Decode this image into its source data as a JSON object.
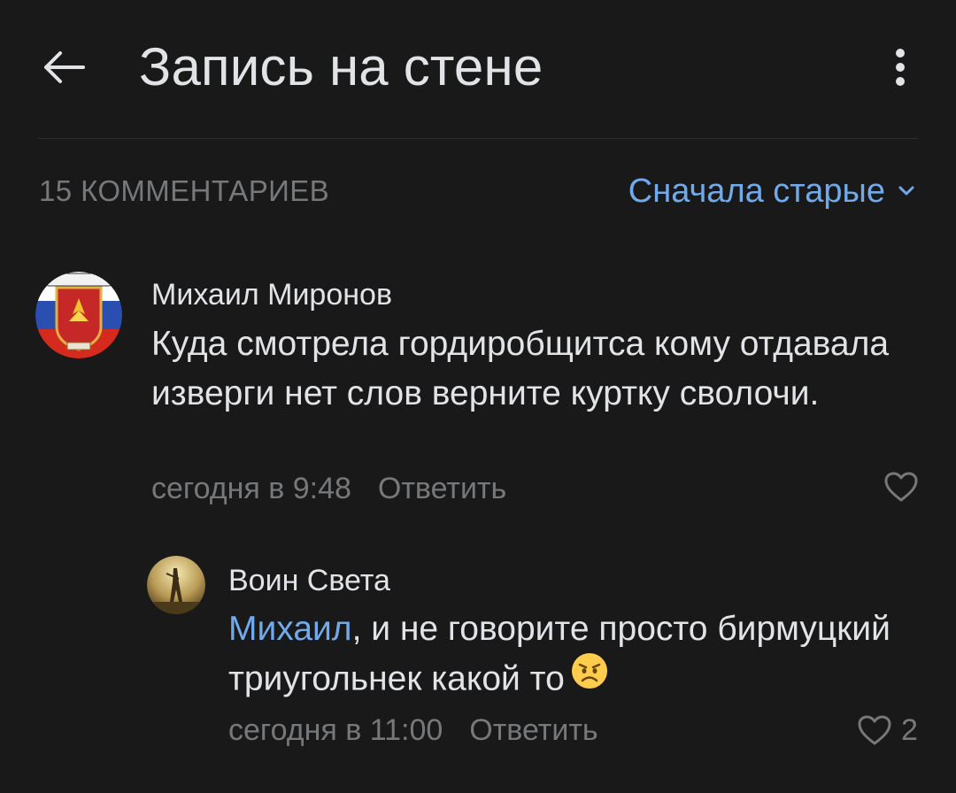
{
  "header": {
    "title": "Запись на стене",
    "back_icon": "arrow-left-icon",
    "more_icon": "more-vertical-icon"
  },
  "comments_header": {
    "count_label": "15 КОММЕНТАРИЕВ",
    "sort_label": "Сначала старые",
    "sort_icon": "chevron-down-icon"
  },
  "comments": [
    {
      "author": "Михаил Миронов",
      "text": "Куда смотрела гордиробщитса кому отдавала изверги нет слов верните куртку сволочи.",
      "time": "сегодня в 9:48",
      "reply_label": "Ответить",
      "likes": ""
    },
    {
      "author": "Воин Света",
      "mention": "Михаил",
      "text": ", и не говорите просто бирмуцкий триугольнек какой то",
      "emoji": "angry-face-emoji",
      "time": "сегодня в 11:00",
      "reply_label": "Ответить",
      "likes": "2"
    }
  ],
  "colors": {
    "background": "#19191a",
    "text_primary": "#e1e3e6",
    "text_secondary": "#76787a",
    "accent": "#71aaeb"
  }
}
